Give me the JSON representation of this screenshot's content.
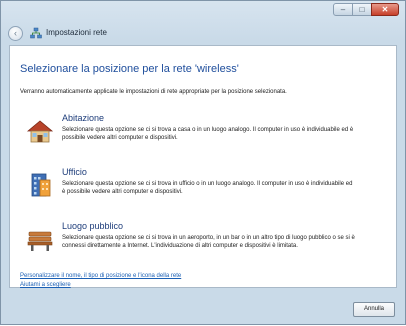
{
  "window": {
    "title": "Impostazioni rete",
    "minimize_glyph": "–",
    "maximize_glyph": "□",
    "close_glyph": "✕",
    "back_glyph": "‹"
  },
  "main": {
    "heading": "Selezionare la posizione per la rete 'wireless'",
    "intro": "Verranno automaticamente applicate le impostazioni di rete appropriate per la posizione selezionata.",
    "options": [
      {
        "icon": "house-icon",
        "title": "Abitazione",
        "description": "Selezionare questa opzione se ci si trova a casa o in un luogo analogo. Il computer in uso è individuabile ed è possibile vedere altri computer e dispositivi."
      },
      {
        "icon": "office-building-icon",
        "title": "Ufficio",
        "description": "Selezionare questa opzione se ci si trova in ufficio o in un luogo analogo. Il computer in uso è individuabile ed è possibile vedere altri computer e dispositivi."
      },
      {
        "icon": "park-bench-icon",
        "title": "Luogo pubblico",
        "description": "Selezionare questa opzione se ci si trova in un aeroporto, in un bar o in un altro tipo di luogo pubblico o se si è connessi direttamente a Internet. L'individuazione di altri computer e dispositivi è limitata."
      }
    ],
    "links": [
      "Personalizzare il nome, il tipo di posizione e l'icona della rete",
      "Aiutami a scegliere"
    ]
  },
  "footer": {
    "cancel_label": "Annulla"
  },
  "colors": {
    "heading": "#1f4e9c",
    "link": "#1a5fb4",
    "frame": "#c9dae8"
  }
}
